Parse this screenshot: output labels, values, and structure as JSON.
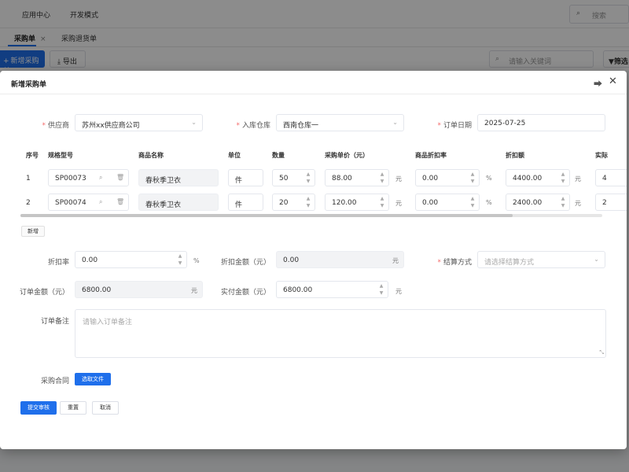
{
  "topnav": {
    "item1": "应用中心",
    "item2": "开发模式",
    "search_placeholder": "搜索"
  },
  "tabs": {
    "tab1": "采购单",
    "tab1_close": "×",
    "tab2": "采购退货单"
  },
  "toolbar": {
    "new_label": "新增采购单",
    "export_label": "导出",
    "search_placeholder": "请输入关键词",
    "filter_label": "筛选"
  },
  "dialog": {
    "title": "新增采购单",
    "supplier_label": "供应商",
    "supplier_value": "苏州xx供应商公司",
    "warehouse_label": "入库仓库",
    "warehouse_value": "西南仓库一",
    "order_date_label": "订单日期",
    "order_date_value": "2025-07-25",
    "table": {
      "headers": [
        "序号",
        "规格型号",
        "商品名称",
        "单位",
        "数量",
        "采购单价（元）",
        "商品折扣率",
        "折扣额",
        "实际"
      ],
      "rows": [
        {
          "idx": "1",
          "spec": "SP00073",
          "name": "春秋季卫衣",
          "unit": "件",
          "qty": "50",
          "price": "88.00",
          "price_unit": "元",
          "discount": "0.00",
          "discount_unit": "%",
          "discount_amount": "4400.00",
          "amount_unit": "元",
          "actual": "4"
        },
        {
          "idx": "2",
          "spec": "SP00074",
          "name": "春秋季卫衣",
          "unit": "件",
          "qty": "20",
          "price": "120.00",
          "price_unit": "元",
          "discount": "0.00",
          "discount_unit": "%",
          "discount_amount": "2400.00",
          "amount_unit": "元",
          "actual": "2"
        }
      ],
      "add_row_label": "新增"
    },
    "discount_rate_label": "折扣率",
    "discount_rate_value": "0.00",
    "discount_rate_unit": "%",
    "discount_amount_label": "折扣金额（元）",
    "discount_amount_value": "0.00",
    "discount_amount_unit": "元",
    "settlement_label": "结算方式",
    "settlement_placeholder": "请选择结算方式",
    "order_amount_label": "订单金额（元）",
    "order_amount_value": "6800.00",
    "order_amount_unit": "元",
    "paid_amount_label": "实付金额（元）",
    "paid_amount_value": "6800.00",
    "paid_amount_unit": "元",
    "remark_label": "订单备注",
    "remark_placeholder": "请输入订单备注",
    "contract_label": "采购合同",
    "choose_file_label": "选取文件",
    "submit_label": "提交审核",
    "reset_label": "重置",
    "cancel_label": "取消"
  },
  "colors": {
    "primary": "#1f6feb",
    "required": "#f56c6c"
  },
  "icons": [
    "search-icon",
    "export-icon",
    "filter-icon",
    "share-icon",
    "close-icon",
    "chevron-down-icon",
    "delete-icon",
    "stepper-icon",
    "resize-icon"
  ]
}
